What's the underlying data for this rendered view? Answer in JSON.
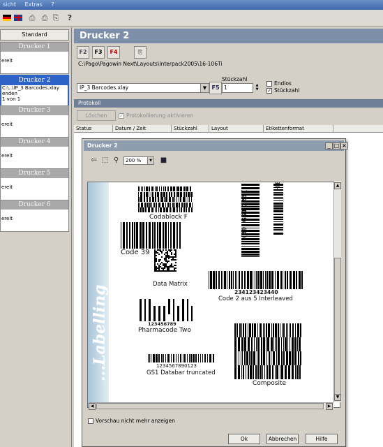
{
  "menu": {
    "items": [
      "sicht",
      "Extras",
      "?"
    ]
  },
  "sidebar": {
    "standard_label": "Standard",
    "printers": [
      {
        "title": "Drucker 1",
        "lines": [
          "ereit"
        ]
      },
      {
        "title": "Drucker 2",
        "lines": [
          "C:\\..\\IP_3 Barcodes.xlay",
          "enden",
          "1 von 1"
        ]
      },
      {
        "title": "Drucker 3",
        "lines": [
          "ereit"
        ]
      },
      {
        "title": "Drucker 4",
        "lines": [
          "ereit"
        ]
      },
      {
        "title": "Drucker 5",
        "lines": [
          "ereit"
        ]
      },
      {
        "title": "Drucker 6",
        "lines": [
          "ereit"
        ]
      }
    ]
  },
  "main": {
    "title": "Drucker 2",
    "f_buttons": [
      "F2",
      "F3",
      "F4"
    ],
    "layout_path": "C:\\Pago\\Pagowin Next\\Layouts\\Interpack2005\\16-106Ti",
    "layout_select": "IP_3 Barcodes.xlay",
    "f5_label": "F5",
    "stueckzahl_label": "Stückzahl",
    "stueckzahl_value": "1",
    "endlos_label": "Endlos",
    "endlos_checked": false,
    "stueckzahl_cb_label": "Stückzahl",
    "stueckzahl_cb_checked": true,
    "protokoll_header": "Protokoll",
    "loeschen_label": "Löschen",
    "protokoll_cb_label": "Protokollierung aktivieren",
    "columns": [
      "Status",
      "Datum / Zeit",
      "Stückzahl",
      "Layout",
      "Etikettenformat"
    ]
  },
  "dialog": {
    "title": "Drucker 2",
    "zoom_value": "200 %",
    "preview_side_text": "...Labelling",
    "barcodes": {
      "codablock": "Codablock F",
      "code39": "Code 39",
      "datamatrix": "Data Matrix",
      "itf_number": "234123423440",
      "itf_label": "Code 2 aus 5 Interleaved",
      "pharma_number": "123456789",
      "pharma_label": "Pharmacode Two",
      "databar_number": "1234567890123",
      "databar_label": "GS1 Databar truncated",
      "composite_label": "Composite",
      "gs1_128_text": "(89) GS1 128 (",
      "hibc_text": "HIBC"
    },
    "no_preview_label": "Vorschau nicht mehr anzeigen",
    "ok_label": "Ok",
    "cancel_label": "Abbrechen",
    "help_label": "Hilfe"
  }
}
